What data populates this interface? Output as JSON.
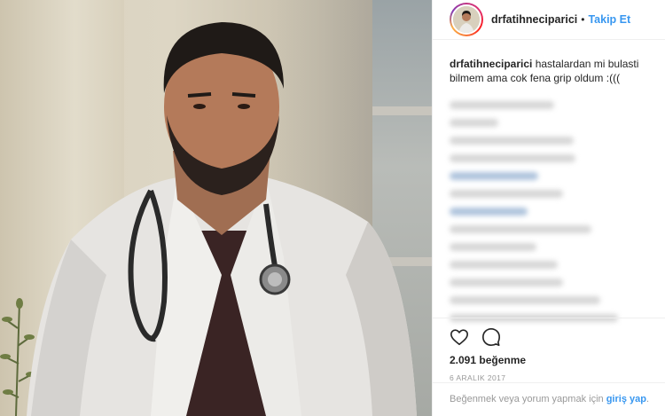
{
  "post": {
    "username": "drfatihneciparici",
    "separator": "•",
    "follow_label": "Takip Et",
    "caption_user": "drfatihneciparici",
    "caption_text": "hastalardan mi bulasti bilmem ama cok fena grip oldum :(((",
    "likes": "2.091 beğenme",
    "date": "6 ARALIK 2017",
    "login_prompt": "Beğenmek veya yorum yapmak için",
    "login_link": "giriş yap",
    "login_end": "."
  },
  "icons": {
    "like": "heart-icon",
    "comment": "comment-icon"
  },
  "colors": {
    "link_blue": "#3897f0",
    "text_dark": "#262626",
    "muted": "#999999"
  }
}
